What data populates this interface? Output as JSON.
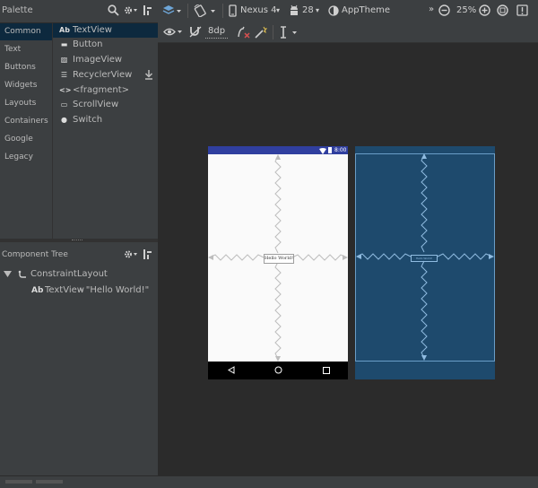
{
  "palette": {
    "title": "Palette",
    "categories": [
      "Common",
      "Text",
      "Buttons",
      "Widgets",
      "Layouts",
      "Containers",
      "Google",
      "Legacy"
    ],
    "widgets": [
      {
        "icon": "Ab",
        "label": "TextView"
      },
      {
        "icon": "▬",
        "label": "Button"
      },
      {
        "icon": "▨",
        "label": "ImageView"
      },
      {
        "icon": "☰",
        "label": "RecyclerView"
      },
      {
        "icon": "<>",
        "label": "<fragment>"
      },
      {
        "icon": "▭",
        "label": "ScrollView"
      },
      {
        "icon": "●",
        "label": "Switch"
      }
    ]
  },
  "component_tree": {
    "title": "Component Tree",
    "root": "ConstraintLayout",
    "child_icon": "Ab",
    "child_name": "TextView",
    "child_detail": " - \"Hello World!\""
  },
  "toolbar": {
    "device": "Nexus 4",
    "api": "28",
    "theme": "AppTheme",
    "zoom": "25%",
    "margin": "8dp"
  },
  "phone": {
    "time": "8:00",
    "textview": "Hello World!"
  },
  "colors": {
    "panel": "#3c3f41",
    "background": "#2b2b2b",
    "selection": "#0d293e",
    "statusbar": "#303f9f",
    "blueprint": "#1e4a6d"
  }
}
